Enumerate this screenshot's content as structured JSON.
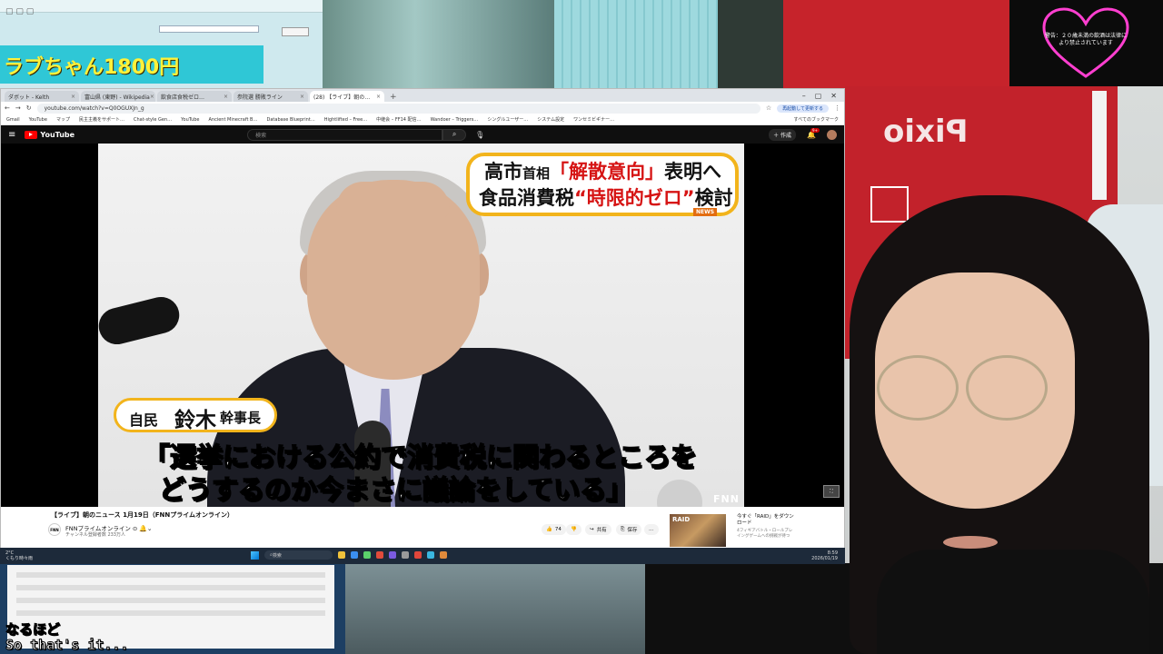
{
  "stream_overlay": {
    "left_monitor_banner": "ラブちゃん1800円",
    "heart_notice": "警告：２０歳未満の飲酒は法律により禁止されています",
    "caption_jp": "なるほど",
    "caption_en": "So that's it..."
  },
  "browser": {
    "tabs": [
      {
        "label": "ダボット - Kelth",
        "active": false
      },
      {
        "label": "富山県 (東野) - Wikipedia",
        "active": false
      },
      {
        "label": "飲食店食税ゼロ…",
        "active": false
      },
      {
        "label": "参院選 勝敗ライン",
        "active": false
      },
      {
        "label": "(28) 【ライブ】朝の…",
        "active": true
      }
    ],
    "url": "youtube.com/watch?v=Q0OGUXJn_g",
    "update_button": "再起動して更新する",
    "bookmarks": [
      "Gmail",
      "YouTube",
      "マップ",
      "民主主義をサポート…",
      "Chat-style Gen…",
      "YouTube",
      "Ancient Minecraft B…",
      "Database Blueprint…",
      "Hightlifted – Free…",
      "中継会 – FF14 配信…",
      "Wandoer – Triggers…",
      "シングルユーザー…",
      "システム設定",
      "ワンセミビギナー…"
    ],
    "bookmarks_folder": "すべてのブックマーク"
  },
  "youtube": {
    "logo": "YouTube",
    "search_placeholder": "検索",
    "create_label": "作成",
    "notif_count": "9+",
    "video": {
      "headline_line1_a": "高市",
      "headline_line1_b": "首相",
      "headline_line1_c": "「解散意向」",
      "headline_line1_d": "表明へ",
      "headline_line2_a": "食品消費税",
      "headline_line2_b": "“時限的ゼロ”",
      "headline_line2_c": "検討",
      "news_tag": "NEWS",
      "name_party": "自民",
      "name_name": "鈴木",
      "name_role": "幹事長",
      "subtitle_line1": "「選挙における公約で消費税に関わるところを",
      "subtitle_line2": "どうするのか今まさに議論をしている」",
      "network_mark": "FNN"
    },
    "title": "【ライブ】朝のニュース 1月19日（FNNプライムオンライン）",
    "channel": {
      "icon_text": "FNN",
      "name": "FNNプライムオンライン ⊙",
      "subscribers": "チャンネル登録者数 233万人"
    },
    "actions": {
      "likes": "74",
      "share": "共有",
      "save": "保存",
      "more": "…"
    },
    "recommendation": {
      "thumb_text": "RAID",
      "title": "今すぐ「RAID」をダウンロード",
      "meta": "4フィギアバトル・ロールプレイングゲームへの挑戦が待つ"
    }
  },
  "taskbar": {
    "weather_temp": "2°C",
    "weather_desc": "くもり時々雨",
    "search_placeholder": "検索",
    "time": "8:59",
    "date": "2026/01/19"
  }
}
